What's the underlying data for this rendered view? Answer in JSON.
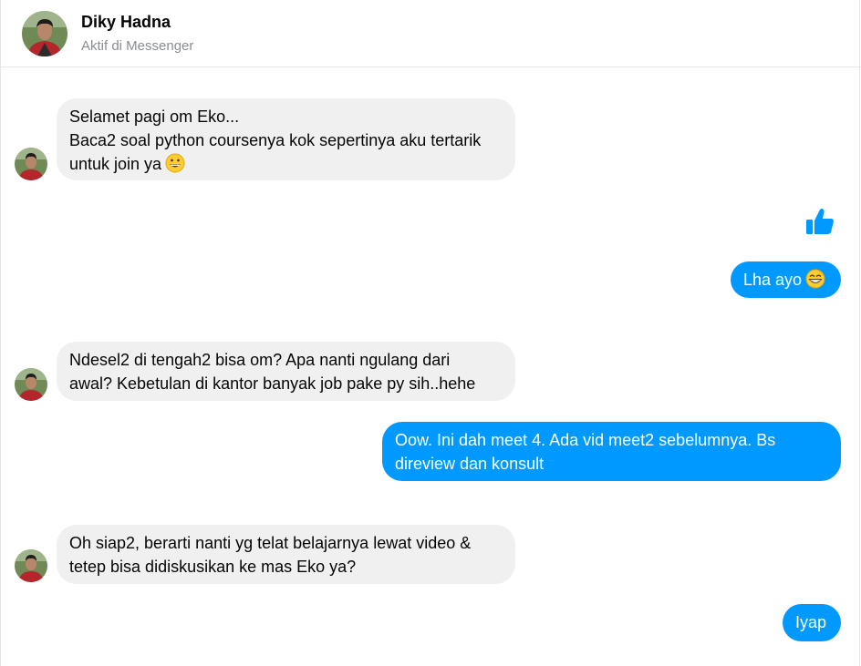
{
  "header": {
    "contact_name": "Diky Hadna",
    "status": "Aktif di Messenger"
  },
  "colors": {
    "outgoing_bubble": "#0099ff",
    "incoming_bubble": "#f0f0f0",
    "like": "#0099ff"
  },
  "messages": {
    "m1": {
      "lines": [
        "Selamet pagi om Eko...",
        "Baca2 soal python coursenya kok sepertinya aku tertarik",
        "untuk join ya"
      ],
      "emoji": "grinning-face-emoji"
    },
    "m2": {
      "icon": "thumbs-up-icon"
    },
    "m3": {
      "text": "Lha ayo",
      "emoji": "grinning-smiling-eyes-emoji"
    },
    "m4": {
      "lines": [
        "Ndesel2 di tengah2 bisa om? Apa nanti ngulang dari",
        "awal? Kebetulan di kantor banyak job pake py sih..hehe"
      ]
    },
    "m5": {
      "lines": [
        "Oow. Ini dah meet 4. Ada vid meet2 sebelumnya. Bs",
        "direview dan konsult"
      ]
    },
    "m6": {
      "lines": [
        "Oh siap2, berarti nanti yg telat belajarnya lewat video &",
        "tetep bisa didiskusikan ke mas Eko ya?"
      ]
    },
    "m7": {
      "text": "Iyap"
    }
  }
}
